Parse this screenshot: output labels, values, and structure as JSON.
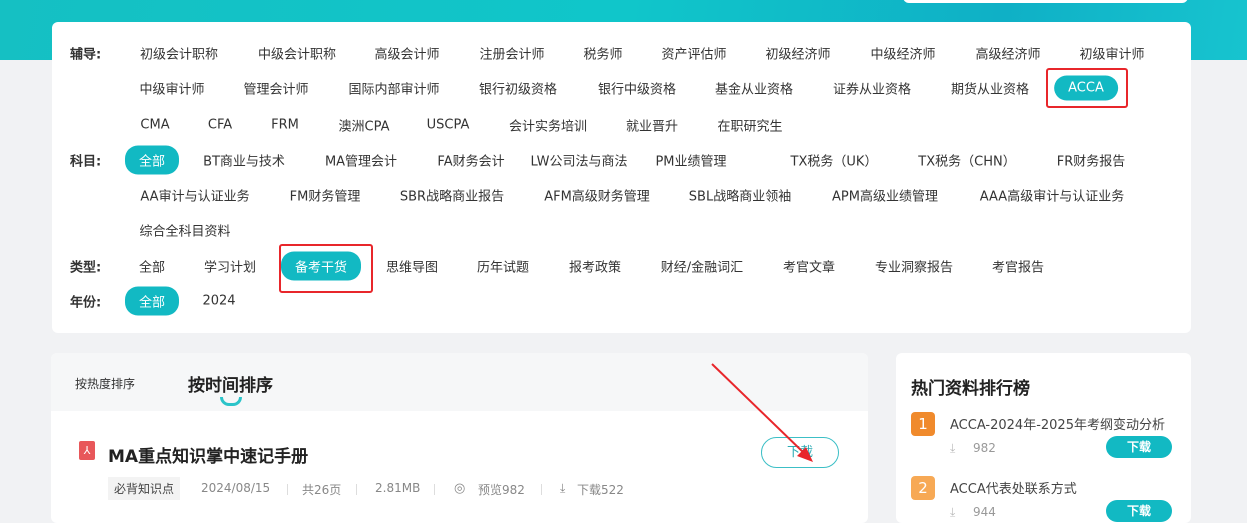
{
  "filters": {
    "tutoring": {
      "label": "辅导:",
      "items": [
        "初级会计职称",
        "中级会计职称",
        "高级会计师",
        "注册会计师",
        "税务师",
        "资产评估师",
        "初级经济师",
        "中级经济师",
        "高级经济师",
        "初级审计师",
        "中级审计师",
        "管理会计师",
        "国际内部审计师",
        "银行初级资格",
        "银行中级资格",
        "基金从业资格",
        "证券从业资格",
        "期货从业资格",
        "ACCA",
        "CMA",
        "CFA",
        "FRM",
        "澳洲CPA",
        "USCPA",
        "会计实务培训",
        "就业晋升",
        "在职研究生"
      ],
      "selected": "ACCA"
    },
    "subject": {
      "label": "科目:",
      "items": [
        "全部",
        "BT商业与技术",
        "MA管理会计",
        "FA财务会计",
        "LW公司法与商法",
        "PM业绩管理",
        "TX税务（UK）",
        "TX税务（CHN）",
        "FR财务报告",
        "AA审计与认证业务",
        "FM财务管理",
        "SBR战略商业报告",
        "AFM高级财务管理",
        "SBL战略商业领袖",
        "APM高级业绩管理",
        "AAA高级审计与认证业务",
        "综合全科目资料"
      ],
      "selected": "全部"
    },
    "type": {
      "label": "类型:",
      "items": [
        "全部",
        "学习计划",
        "备考干货",
        "思维导图",
        "历年试题",
        "报考政策",
        "财经/金融词汇",
        "考官文章",
        "专业洞察报告",
        "考官报告"
      ],
      "selected": "备考干货"
    },
    "year": {
      "label": "年份:",
      "items": [
        "全部",
        "2024"
      ],
      "selected": "全部"
    }
  },
  "sort": {
    "tabs": [
      "按热度排序",
      "按时间排序"
    ],
    "active": "按时间排序"
  },
  "document": {
    "icon": "pdf-icon",
    "title": "MA重点知识掌中速记手册",
    "tag": "必背知识点",
    "date": "2024/08/15",
    "pages": "共26页",
    "size": "2.81MB",
    "preview": "预览982",
    "downloads": "下载522",
    "download_label": "下载"
  },
  "ranking": {
    "title": "热门资料排行榜",
    "items": [
      {
        "rank": "1",
        "title": "ACCA-2024年-2025年考纲变动分析",
        "count": "982",
        "button": "下载",
        "color": "#f08a2c"
      },
      {
        "rank": "2",
        "title": "ACCA代表处联系方式",
        "count": "944",
        "button": "下载",
        "color": "#f7a955"
      }
    ]
  },
  "accent": "#12b9c3"
}
